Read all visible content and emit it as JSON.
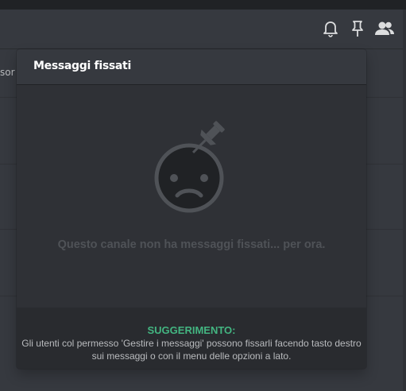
{
  "header": {
    "icons": [
      {
        "name": "bell-icon"
      },
      {
        "name": "pin-icon"
      },
      {
        "name": "members-icon"
      }
    ]
  },
  "background": {
    "fragment_text": "sor"
  },
  "pinned_popout": {
    "title": "Messaggi fissati",
    "empty_message": "Questo canale non ha messaggi fissati... per ora.",
    "empty_illustration": "sad-face-with-pin-icon",
    "tip_label": "SUGGERIMENTO:",
    "tip_text": "Gli utenti col permesso 'Gestire i messaggi' possono fissarli facendo tasto destro sui messaggi o con il menu delle opzioni a lato."
  },
  "colors": {
    "background": "#36393f",
    "popout": "#2f3136",
    "footer": "#292b2f",
    "tip_accent": "#43b581",
    "muted_text": "#4f5257",
    "body_text": "#b9bbbe"
  }
}
